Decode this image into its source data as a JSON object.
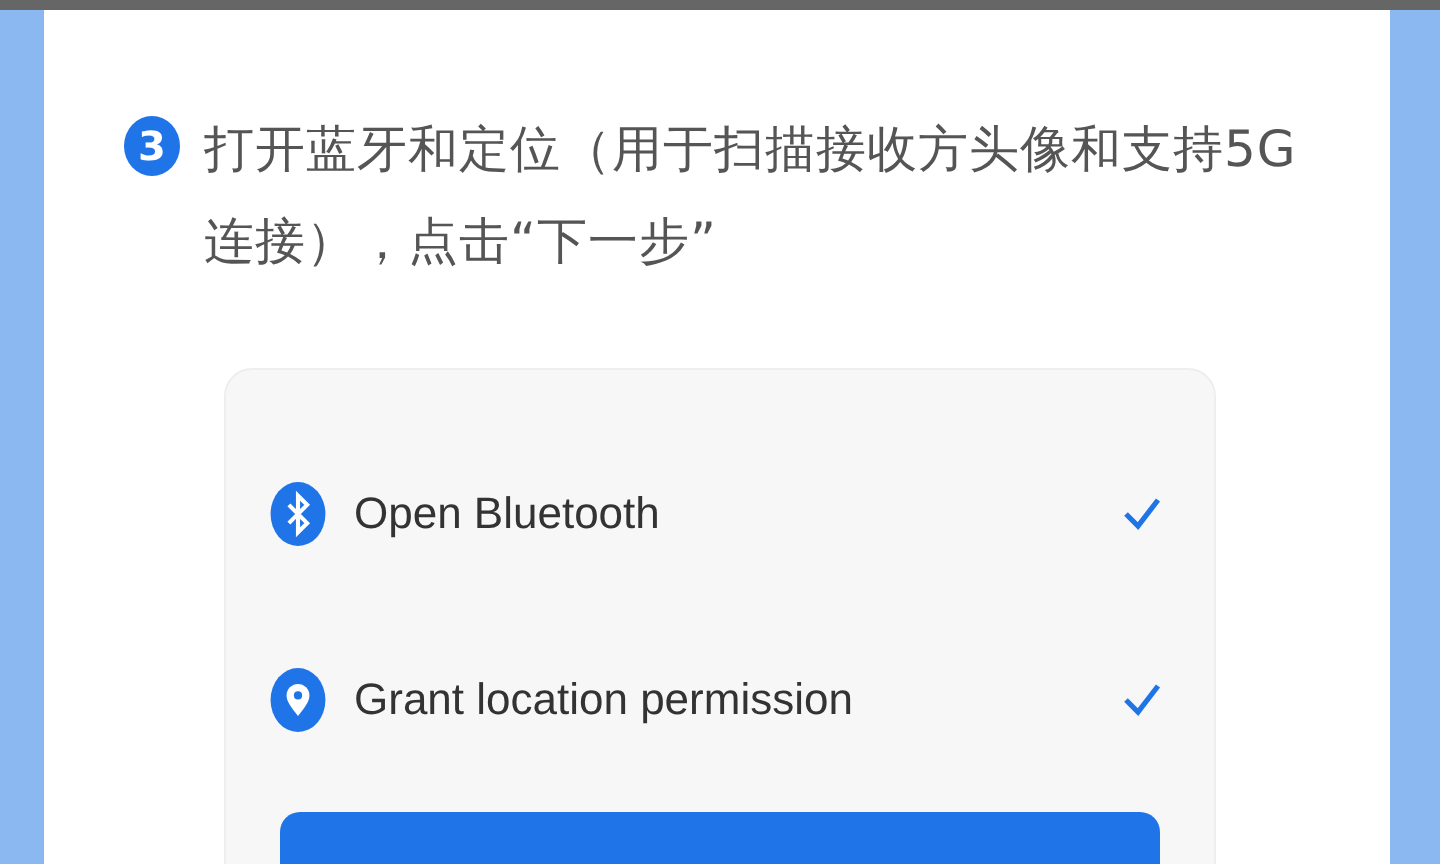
{
  "step": {
    "number": "3",
    "text": "打开蓝牙和定位（用于扫描接收方头像和支持5G连接），点击“下一步”"
  },
  "permissions": [
    {
      "kind": "bluetooth",
      "label": "Open Bluetooth",
      "checked": true
    },
    {
      "kind": "location",
      "label": "Grant location permission",
      "checked": true
    }
  ]
}
